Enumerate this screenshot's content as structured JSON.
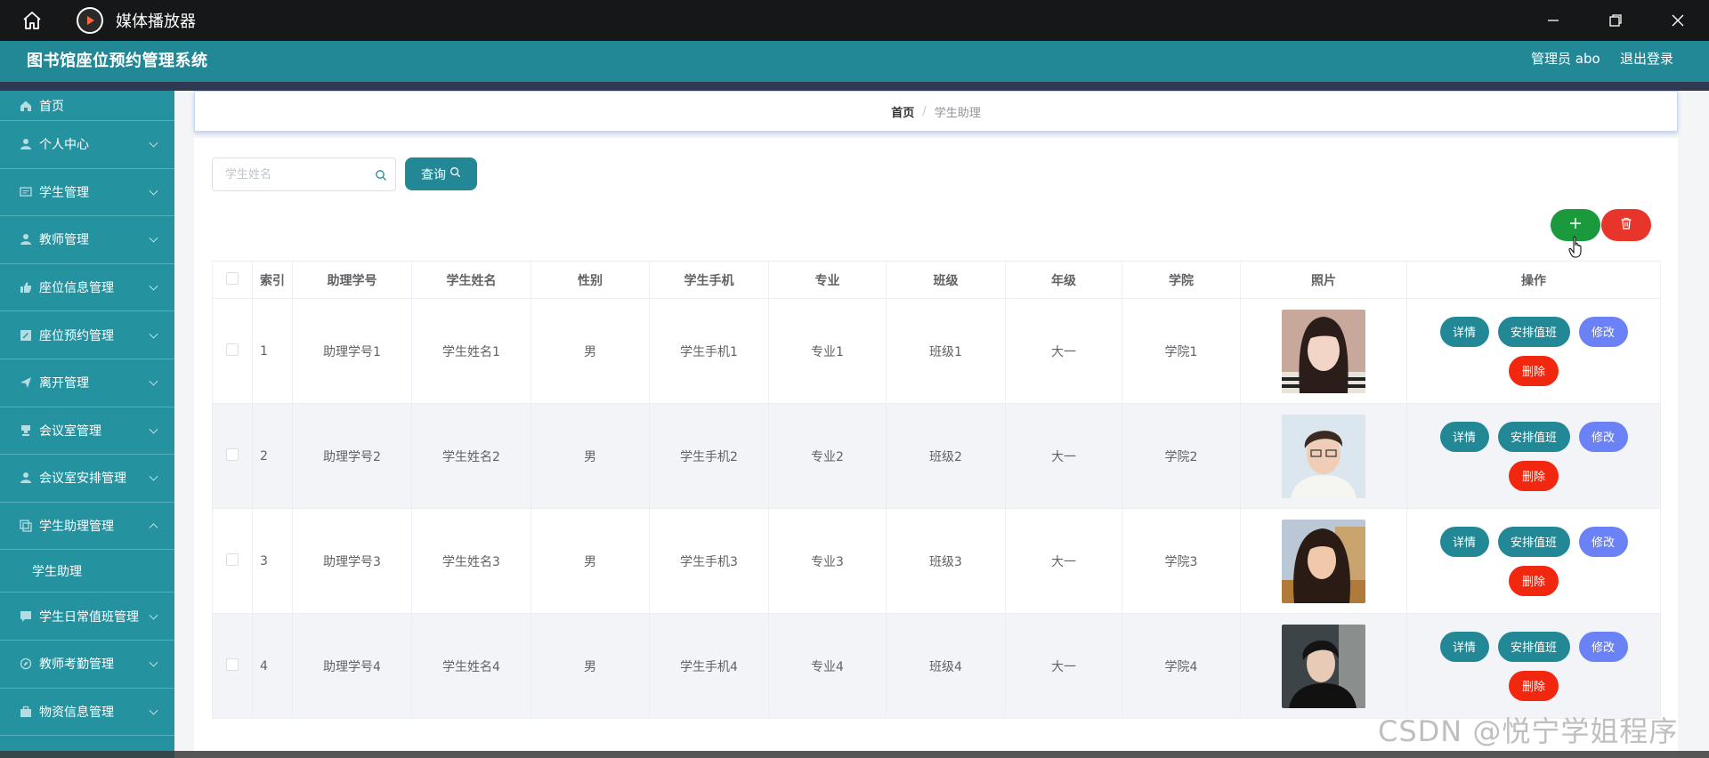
{
  "window": {
    "title": "媒体播放器"
  },
  "header": {
    "app_title": "图书馆座位预约管理系统",
    "user": "管理员 abo",
    "logout": "退出登录"
  },
  "sidebar": {
    "items": [
      {
        "label": "首页",
        "icon": "home-icon",
        "expanded": false,
        "has_arrow": false
      },
      {
        "label": "个人中心",
        "icon": "user-icon",
        "expanded": false,
        "has_arrow": true
      },
      {
        "label": "学生管理",
        "icon": "message-icon",
        "expanded": false,
        "has_arrow": true
      },
      {
        "label": "教师管理",
        "icon": "user-icon",
        "expanded": false,
        "has_arrow": true
      },
      {
        "label": "座位信息管理",
        "icon": "thumb-icon",
        "expanded": false,
        "has_arrow": true
      },
      {
        "label": "座位预约管理",
        "icon": "edit-icon",
        "expanded": false,
        "has_arrow": true
      },
      {
        "label": "离开管理",
        "icon": "send-icon",
        "expanded": false,
        "has_arrow": true
      },
      {
        "label": "会议室管理",
        "icon": "cup-icon",
        "expanded": false,
        "has_arrow": true
      },
      {
        "label": "会议室安排管理",
        "icon": "user-icon",
        "expanded": false,
        "has_arrow": true
      },
      {
        "label": "学生助理管理",
        "icon": "copy-icon",
        "expanded": true,
        "has_arrow": true
      },
      {
        "label": "学生日常值班管理",
        "icon": "chat-icon",
        "expanded": false,
        "has_arrow": true
      },
      {
        "label": "教师考勤管理",
        "icon": "compass-icon",
        "expanded": false,
        "has_arrow": true
      },
      {
        "label": "物资信息管理",
        "icon": "briefcase-icon",
        "expanded": false,
        "has_arrow": true
      }
    ],
    "sub_item": "学生助理"
  },
  "breadcrumb": {
    "home": "首页",
    "separator": "/",
    "current": "学生助理"
  },
  "search": {
    "placeholder": "学生姓名",
    "button": "查询"
  },
  "table": {
    "columns": [
      "索引",
      "助理学号",
      "学生姓名",
      "性别",
      "学生手机",
      "专业",
      "班级",
      "年级",
      "学院",
      "照片",
      "操作"
    ],
    "rows": [
      {
        "index": "1",
        "assistant_no": "助理学号1",
        "name": "学生姓名1",
        "gender": "男",
        "phone": "学生手机1",
        "major": "专业1",
        "class": "班级1",
        "grade": "大一",
        "college": "学院1"
      },
      {
        "index": "2",
        "assistant_no": "助理学号2",
        "name": "学生姓名2",
        "gender": "男",
        "phone": "学生手机2",
        "major": "专业2",
        "class": "班级2",
        "grade": "大一",
        "college": "学院2"
      },
      {
        "index": "3",
        "assistant_no": "助理学号3",
        "name": "学生姓名3",
        "gender": "男",
        "phone": "学生手机3",
        "major": "专业3",
        "class": "班级3",
        "grade": "大一",
        "college": "学院3"
      },
      {
        "index": "4",
        "assistant_no": "助理学号4",
        "name": "学生姓名4",
        "gender": "男",
        "phone": "学生手机4",
        "major": "专业4",
        "class": "班级4",
        "grade": "大一",
        "college": "学院4"
      }
    ],
    "actions": {
      "detail": "详情",
      "arrange": "安排值班",
      "edit": "修改",
      "delete": "删除"
    }
  },
  "watermark": "CSDN @悦宁学姐程序",
  "colors": {
    "title_bar": "#161718",
    "header": "#238896",
    "sidebar": "#2592a0",
    "primary": "#238896",
    "edit": "#6a82f6",
    "danger": "#f2270f",
    "add": "#1a9a3d"
  }
}
